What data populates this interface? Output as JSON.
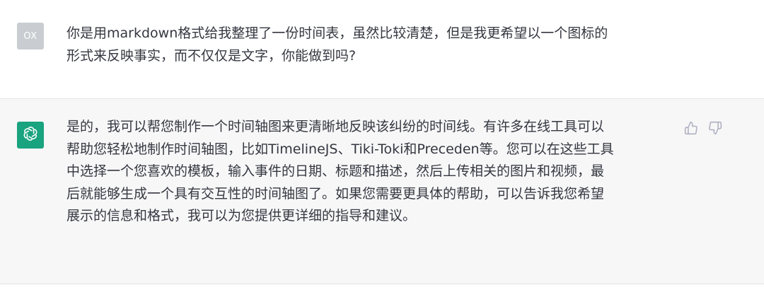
{
  "user_message": {
    "avatar_initials": "OX",
    "lines": [
      "你是用markdown格式给我整理了一份时间表，虽然比较清楚，但是我更希望以一个图标的",
      "形式来反映事实，而不仅仅是文字，你能做到吗?"
    ]
  },
  "assistant_message": {
    "avatar_icon": "openai-logo-icon",
    "lines": [
      "是的，我可以帮您制作一个时间轴图来更清晰地反映该纠纷的时间线。有许多在线工具可以",
      "帮助您轻松地制作时间轴图，比如TimelineJS、Tiki-Toki和Preceden等。您可以在这些工具",
      "中选择一个您喜欢的模板，输入事件的日期、标题和描述，然后上传相关的图片和视频，最",
      "后就能够生成一个具有交互性的时间轴图了。如果您需要更具体的帮助，可以告诉我您希望",
      "展示的信息和格式，我可以为您提供更详细的指导和建议。"
    ],
    "feedback": {
      "thumbs_up_icon": "thumbs-up-icon",
      "thumbs_down_icon": "thumbs-down-icon"
    }
  },
  "colors": {
    "assistant_bg": "#f7f7f8",
    "user_avatar_bg": "#c9cdd1",
    "assistant_avatar_bg": "#19a37f",
    "text": "#353740",
    "icon_gray": "#acacbe"
  }
}
